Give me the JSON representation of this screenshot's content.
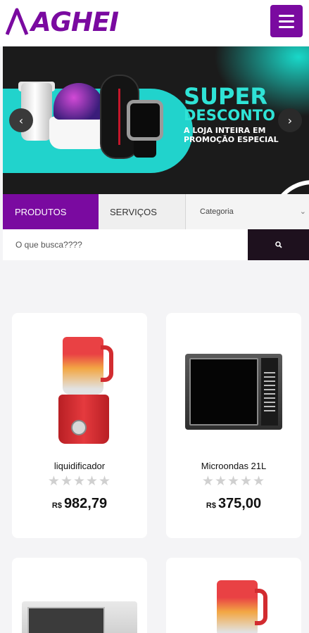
{
  "header": {
    "logo_text": "AGHEI",
    "menu_icon": "hamburger-icon"
  },
  "banner": {
    "line1": "SUPER",
    "line2": "DESCONTO",
    "line3": "A LOJA INTEIRA EM",
    "line4": "PROMOÇÃO ESPECIAL",
    "prev": "‹",
    "next": "›"
  },
  "tabs": {
    "products": "PRODUTOS",
    "services": "SERVIÇOS",
    "category": "Categoria"
  },
  "search": {
    "placeholder": "O que busca????",
    "button_icon": "search-icon"
  },
  "products": [
    {
      "name": "liquidificador",
      "currency": "R$",
      "price": "982,79",
      "stars": "★★★★★",
      "rating": 0
    },
    {
      "name": "Microondas 21L",
      "currency": "R$",
      "price": "375,00",
      "stars": "★★★★★",
      "rating": 0
    }
  ],
  "colors": {
    "brand": "#7a0aa0",
    "accent": "#21d3cc",
    "search_button": "#1e111e"
  }
}
